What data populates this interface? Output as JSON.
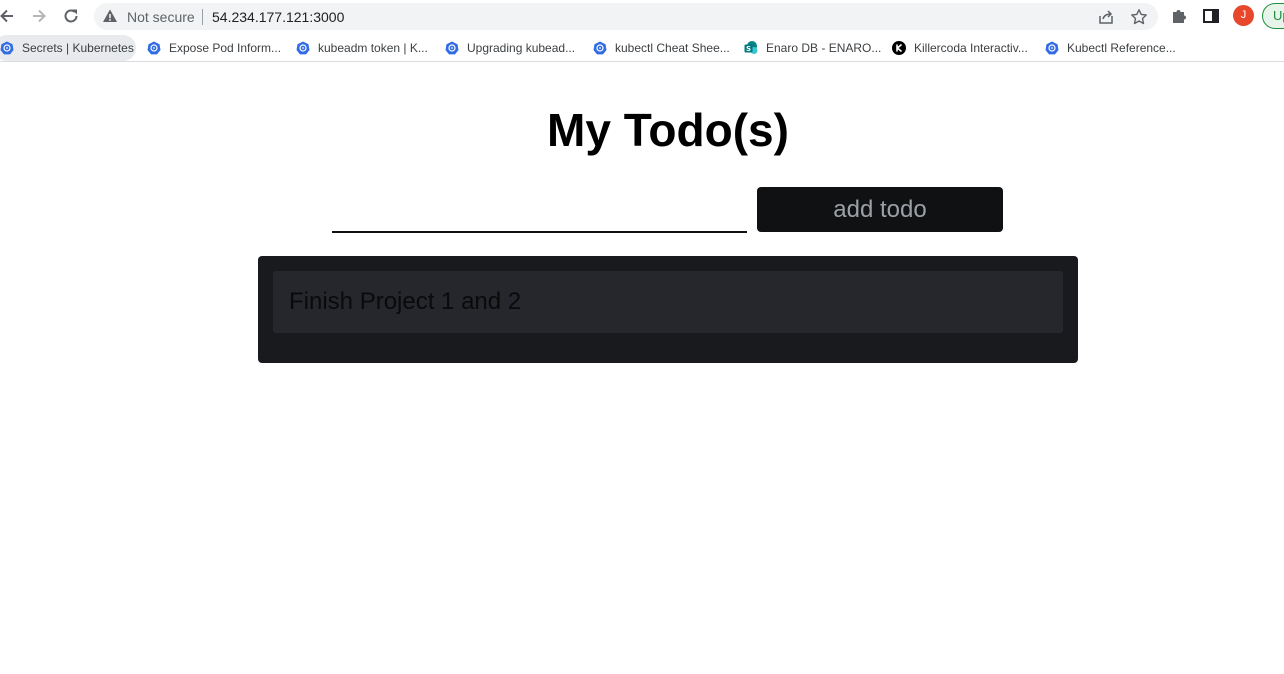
{
  "browser": {
    "security_label": "Not secure",
    "url": "54.234.177.121:3000",
    "avatar_initial": "J",
    "update_label": "Up",
    "bookmarks": [
      {
        "label": "Secrets | Kubernetes",
        "icon": "kubernetes-icon"
      },
      {
        "label": "Expose Pod Inform...",
        "icon": "kubernetes-icon"
      },
      {
        "label": "kubeadm token | K...",
        "icon": "kubernetes-icon"
      },
      {
        "label": "Upgrading kubead...",
        "icon": "kubernetes-icon"
      },
      {
        "label": "kubectl Cheat Shee...",
        "icon": "kubernetes-icon"
      },
      {
        "label": "Enaro DB - ENARO...",
        "icon": "sharepoint-icon"
      },
      {
        "label": "Killercoda Interactiv...",
        "icon": "killercoda-icon"
      },
      {
        "label": "Kubectl Reference...",
        "icon": "kubernetes-icon"
      }
    ]
  },
  "app": {
    "title": "My Todo(s)",
    "input_value": "",
    "add_button_label": "add todo",
    "todos": [
      {
        "text": "Finish Project 1 and 2"
      }
    ]
  },
  "colors": {
    "kubernetes": "#326ce5",
    "panel": "#181a1e",
    "item": "#25272d",
    "button": "#0f1113"
  }
}
